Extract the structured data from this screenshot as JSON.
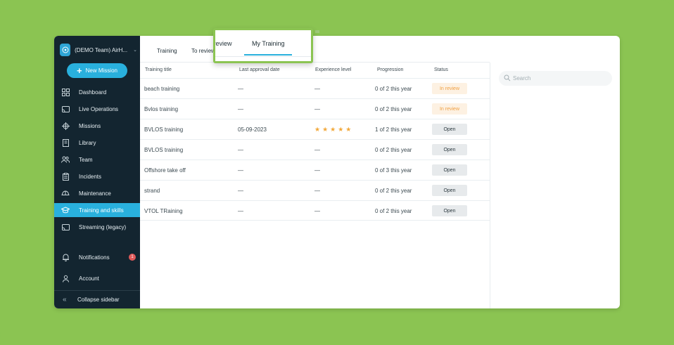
{
  "sidebar": {
    "team_name": "(DEMO Team) AirH...",
    "new_mission_label": "New Mission",
    "items": [
      {
        "label": "Dashboard",
        "icon": "grid-icon"
      },
      {
        "label": "Live Operations",
        "icon": "cast-icon"
      },
      {
        "label": "Missions",
        "icon": "crosshair-icon"
      },
      {
        "label": "Library",
        "icon": "book-icon"
      },
      {
        "label": "Team",
        "icon": "people-icon"
      },
      {
        "label": "Incidents",
        "icon": "clipboard-icon"
      },
      {
        "label": "Maintenance",
        "icon": "hardhat-icon"
      },
      {
        "label": "Training and skills",
        "icon": "graduation-cap-icon",
        "active": true
      },
      {
        "label": "Streaming (legacy)",
        "icon": "cast-icon"
      }
    ],
    "notifications_label": "Notifications",
    "notifications_count": "1",
    "account_label": "Account",
    "collapse_label": "Collapse sidebar"
  },
  "tabs": {
    "training": "Training",
    "to_review": "To review"
  },
  "zoom": {
    "tab_to_review_partial": "o review",
    "tab_my_training": "My Training"
  },
  "table": {
    "headers": {
      "title": "Training title",
      "approval": "Last approval date",
      "experience": "Experience level",
      "progression": "Progression",
      "status": "Status"
    },
    "rows": [
      {
        "title": "beach training",
        "approval": "—",
        "experience": "—",
        "progression": "0 of 2 this year",
        "status": "In review"
      },
      {
        "title": "Bvlos training",
        "approval": "—",
        "experience": "—",
        "progression": "0 of 2 this year",
        "status": "In review"
      },
      {
        "title": "BVLOS training",
        "approval": "05-09-2023",
        "experience": "★★★★★",
        "progression": "1 of 2 this year",
        "status": "Open"
      },
      {
        "title": "BVLOS training",
        "approval": "—",
        "experience": "—",
        "progression": "0 of 2 this year",
        "status": "Open"
      },
      {
        "title": "Offshore take off",
        "approval": "—",
        "experience": "—",
        "progression": "0 of 3 this year",
        "status": "Open"
      },
      {
        "title": "strand",
        "approval": "—",
        "experience": "—",
        "progression": "0 of 2 this year",
        "status": "Open"
      },
      {
        "title": "VTOL TRaining",
        "approval": "—",
        "experience": "—",
        "progression": "0 of 2 this year",
        "status": "Open"
      }
    ]
  },
  "search": {
    "placeholder": "Search"
  },
  "colors": {
    "background": "#8bc452",
    "sidebar": "#132530",
    "accent": "#29b0dd",
    "review_text": "#f0a044",
    "star": "#f2a83a"
  }
}
